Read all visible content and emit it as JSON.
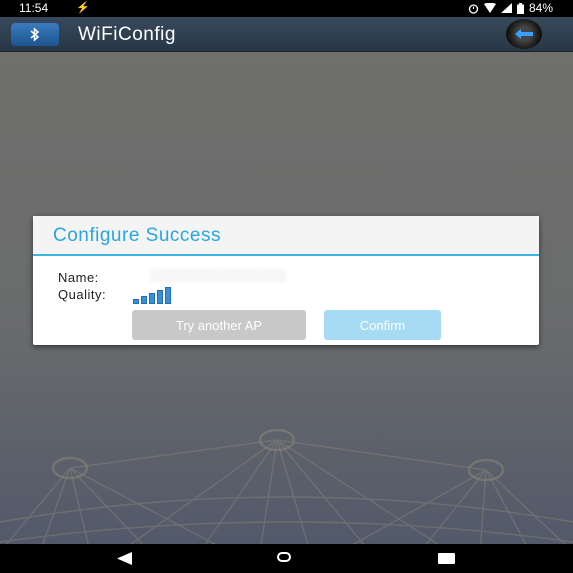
{
  "status_bar": {
    "time": "11:54",
    "battery": "84%"
  },
  "app_bar": {
    "title": "WiFiConfig"
  },
  "dialog": {
    "title": "Configure Success",
    "name_label": "Name:",
    "quality_label": "Quality:",
    "name_value": "░░░░░░░░░░░░░░░░",
    "quality_level": 5,
    "secondary_button": "Try another AP",
    "primary_button": "Confirm"
  },
  "colors": {
    "accent": "#2aa6dc",
    "app_bar": "#2f4050"
  },
  "icons": [
    "bluetooth-icon",
    "back-arrow-icon",
    "nav-back-icon",
    "nav-home-icon",
    "nav-recents-icon"
  ]
}
